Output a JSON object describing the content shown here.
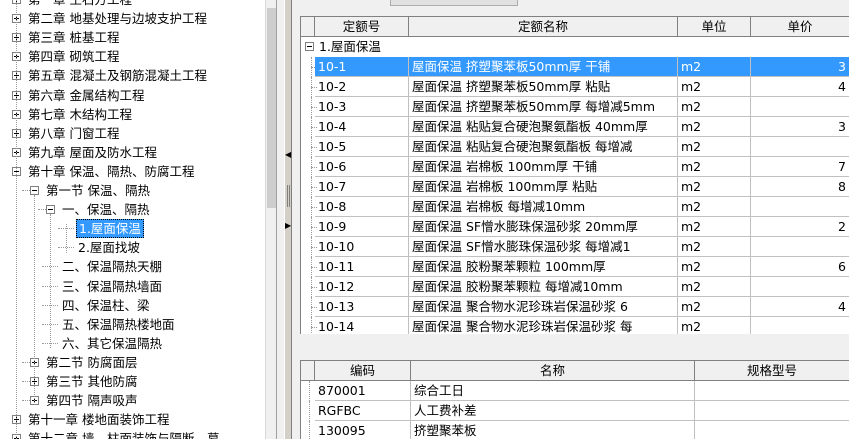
{
  "tree": {
    "items": [
      {
        "label": "第一章 土石方工程",
        "level": 0,
        "expander": "plus"
      },
      {
        "label": "第二章 地基处理与边坡支护工程",
        "level": 0,
        "expander": "plus"
      },
      {
        "label": "第三章 桩基工程",
        "level": 0,
        "expander": "plus"
      },
      {
        "label": "第四章 砌筑工程",
        "level": 0,
        "expander": "plus"
      },
      {
        "label": "第五章 混凝土及钢筋混凝土工程",
        "level": 0,
        "expander": "plus"
      },
      {
        "label": "第六章 金属结构工程",
        "level": 0,
        "expander": "plus"
      },
      {
        "label": "第七章 木结构工程",
        "level": 0,
        "expander": "plus"
      },
      {
        "label": "第八章 门窗工程",
        "level": 0,
        "expander": "plus"
      },
      {
        "label": "第九章 屋面及防水工程",
        "level": 0,
        "expander": "plus"
      },
      {
        "label": "第十章 保温、隔热、防腐工程",
        "level": 0,
        "expander": "minus"
      },
      {
        "label": "第一节 保温、隔热",
        "level": 1,
        "expander": "minus"
      },
      {
        "label": "一、保温、隔热",
        "level": 2,
        "expander": "minus"
      },
      {
        "label": "1.屋面保温",
        "level": 3,
        "expander": "none",
        "selected": true
      },
      {
        "label": "2.屋面找坡",
        "level": 3,
        "expander": "none"
      },
      {
        "label": "二、保温隔热天棚",
        "level": 2,
        "expander": "none"
      },
      {
        "label": "三、保温隔热墙面",
        "level": 2,
        "expander": "none"
      },
      {
        "label": "四、保温柱、梁",
        "level": 2,
        "expander": "none"
      },
      {
        "label": "五、保温隔热楼地面",
        "level": 2,
        "expander": "none"
      },
      {
        "label": "六、其它保温隔热",
        "level": 2,
        "expander": "none"
      },
      {
        "label": "第二节 防腐面层",
        "level": 1,
        "expander": "plus"
      },
      {
        "label": "第三节 其他防腐",
        "level": 1,
        "expander": "plus"
      },
      {
        "label": "第四节 隔声吸声",
        "level": 1,
        "expander": "plus"
      },
      {
        "label": "第十一章 楼地面装饰工程",
        "level": 0,
        "expander": "plus"
      },
      {
        "label": "第十二章 墙、柱面装饰与隔断、幕",
        "level": 0,
        "expander": "plus"
      }
    ]
  },
  "quota_grid": {
    "headers": [
      "定额号",
      "定额名称",
      "单位",
      "单价"
    ],
    "group_label": "1.屋面保温",
    "rows": [
      {
        "code": "10-1",
        "name": "屋面保温 挤塑聚苯板50mm厚 干铺",
        "unit": "m2",
        "price": "3",
        "selected": true
      },
      {
        "code": "10-2",
        "name": "屋面保温 挤塑聚苯板50mm厚 粘贴",
        "unit": "m2",
        "price": "4"
      },
      {
        "code": "10-3",
        "name": "屋面保温 挤塑聚苯板50mm厚 每增减5mm",
        "unit": "m2",
        "price": ""
      },
      {
        "code": "10-4",
        "name": "屋面保温 粘贴复合硬泡聚氨酯板 40mm厚",
        "unit": "m2",
        "price": "3"
      },
      {
        "code": "10-5",
        "name": "屋面保温 粘贴复合硬泡聚氨酯板 每增减",
        "unit": "m2",
        "price": ""
      },
      {
        "code": "10-6",
        "name": "屋面保温 岩棉板 100mm厚 干铺",
        "unit": "m2",
        "price": "7"
      },
      {
        "code": "10-7",
        "name": "屋面保温 岩棉板 100mm厚 粘贴",
        "unit": "m2",
        "price": "8"
      },
      {
        "code": "10-8",
        "name": "屋面保温 岩棉板 每增减10mm",
        "unit": "m2",
        "price": ""
      },
      {
        "code": "10-9",
        "name": "屋面保温 SF憎水膨珠保温砂浆 20mm厚",
        "unit": "m2",
        "price": "2"
      },
      {
        "code": "10-10",
        "name": "屋面保温 SF憎水膨珠保温砂浆 每增减1",
        "unit": "m2",
        "price": ""
      },
      {
        "code": "10-11",
        "name": "屋面保温 胶粉聚苯颗粒 100mm厚",
        "unit": "m2",
        "price": "6"
      },
      {
        "code": "10-12",
        "name": "屋面保温 胶粉聚苯颗粒 每增减10mm",
        "unit": "m2",
        "price": ""
      },
      {
        "code": "10-13",
        "name": "屋面保温 聚合物水泥珍珠岩保温砂浆 6",
        "unit": "m2",
        "price": "4"
      },
      {
        "code": "10-14",
        "name": "屋面保温 聚合物水泥珍珠岩保温砂浆 每",
        "unit": "m2",
        "price": ""
      }
    ]
  },
  "material_grid": {
    "headers": [
      "编码",
      "名称",
      "规格型号"
    ],
    "rows": [
      {
        "code": "870001",
        "name": "综合工日",
        "spec": ""
      },
      {
        "code": "RGFBC",
        "name": "人工费补差",
        "spec": ""
      },
      {
        "code": "130095",
        "name": "挤塑聚苯板",
        "spec": ""
      }
    ]
  },
  "colors": {
    "selection": "#3399ff",
    "panel_bg": "#f0f0f0",
    "header_bg": "#f0f0f0"
  }
}
